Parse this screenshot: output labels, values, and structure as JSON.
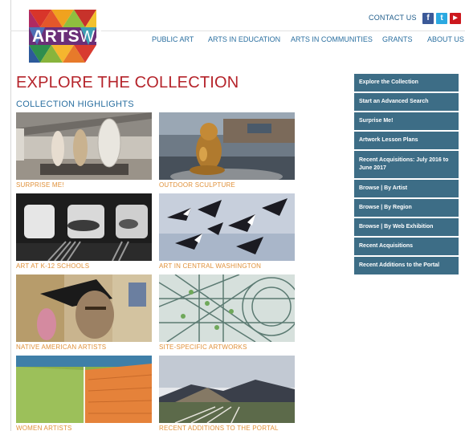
{
  "header": {
    "logo_text_main": "ARTS",
    "logo_text_suffix": "WA",
    "contact_label": "CONTACT US",
    "social": [
      {
        "name": "facebook-icon",
        "glyph": "f",
        "color": "#3b5998"
      },
      {
        "name": "twitter-icon",
        "glyph": "t",
        "color": "#2ba9e1"
      },
      {
        "name": "youtube-icon",
        "glyph": "▶",
        "color": "#cc181e"
      }
    ],
    "nav": [
      "PUBLIC ART",
      "ARTS IN EDUCATION",
      "ARTS IN COMMUNITIES",
      "GRANTS",
      "ABOUT US"
    ]
  },
  "main": {
    "title": "EXPLORE THE COLLECTION",
    "subtitle": "COLLECTION HIGHLIGHTS",
    "tiles": [
      {
        "caption": "SURPRISE ME!"
      },
      {
        "caption": "OUTDOOR SCULPTURE"
      },
      {
        "caption": "ART AT K-12 SCHOOLS"
      },
      {
        "caption": "ART IN CENTRAL WASHINGTON"
      },
      {
        "caption": "NATIVE AMERICAN ARTISTS"
      },
      {
        "caption": "SITE-SPECIFIC ARTWORKS"
      },
      {
        "caption": "WOMEN ARTISTS"
      },
      {
        "caption": "RECENT ADDITIONS TO THE PORTAL"
      }
    ]
  },
  "sidebar": {
    "items": [
      {
        "label": "Explore the Collection"
      },
      {
        "label": "Start an Advanced Search"
      },
      {
        "label": "Surprise Me!"
      },
      {
        "label": "Artwork Lesson Plans"
      },
      {
        "label": "Recent Acquisitions: July 2016 to June 2017"
      },
      {
        "label": "Browse | By Artist"
      },
      {
        "label": "Browse | By Region"
      },
      {
        "label": "Browse | By Web Exhibition"
      },
      {
        "label": "Recent Acquisitions"
      },
      {
        "label": "Recent Additions to the Portal"
      }
    ]
  },
  "colors": {
    "title_red": "#b5242b",
    "link_blue": "#2a6fa0",
    "caption_orange": "#e0913a",
    "sidebar_bg": "#3d6d86"
  }
}
